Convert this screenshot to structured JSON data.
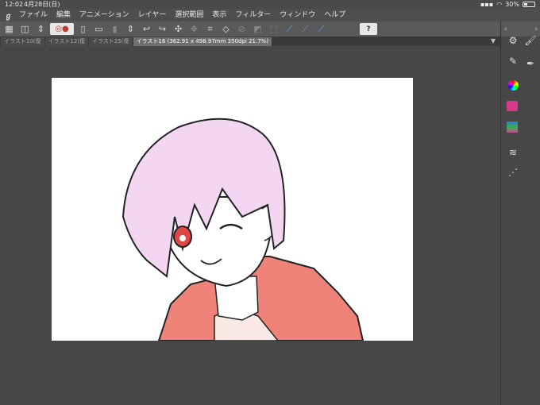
{
  "status": {
    "time": "12:02",
    "date": "4月28日(日)",
    "battery": "30%",
    "battery_level": 0.3
  },
  "menu": {
    "items": [
      "ファイル",
      "編集",
      "アニメーション",
      "レイヤー",
      "選択範囲",
      "表示",
      "フィルター",
      "ウィンドウ",
      "ヘルプ"
    ]
  },
  "tabs": [
    {
      "label": "イラスト10(復"
    },
    {
      "label": "イラスト12(復"
    },
    {
      "label": "イラスト25(復"
    },
    {
      "label": "イラスト16 (362.91 x 498.97mm 350dpi 21.7%)"
    }
  ],
  "toolbar": {
    "help_label": "?"
  },
  "colors": {
    "hair": "#f2d6f2",
    "hoodie": "#ef8379",
    "eye": "#e04646"
  }
}
